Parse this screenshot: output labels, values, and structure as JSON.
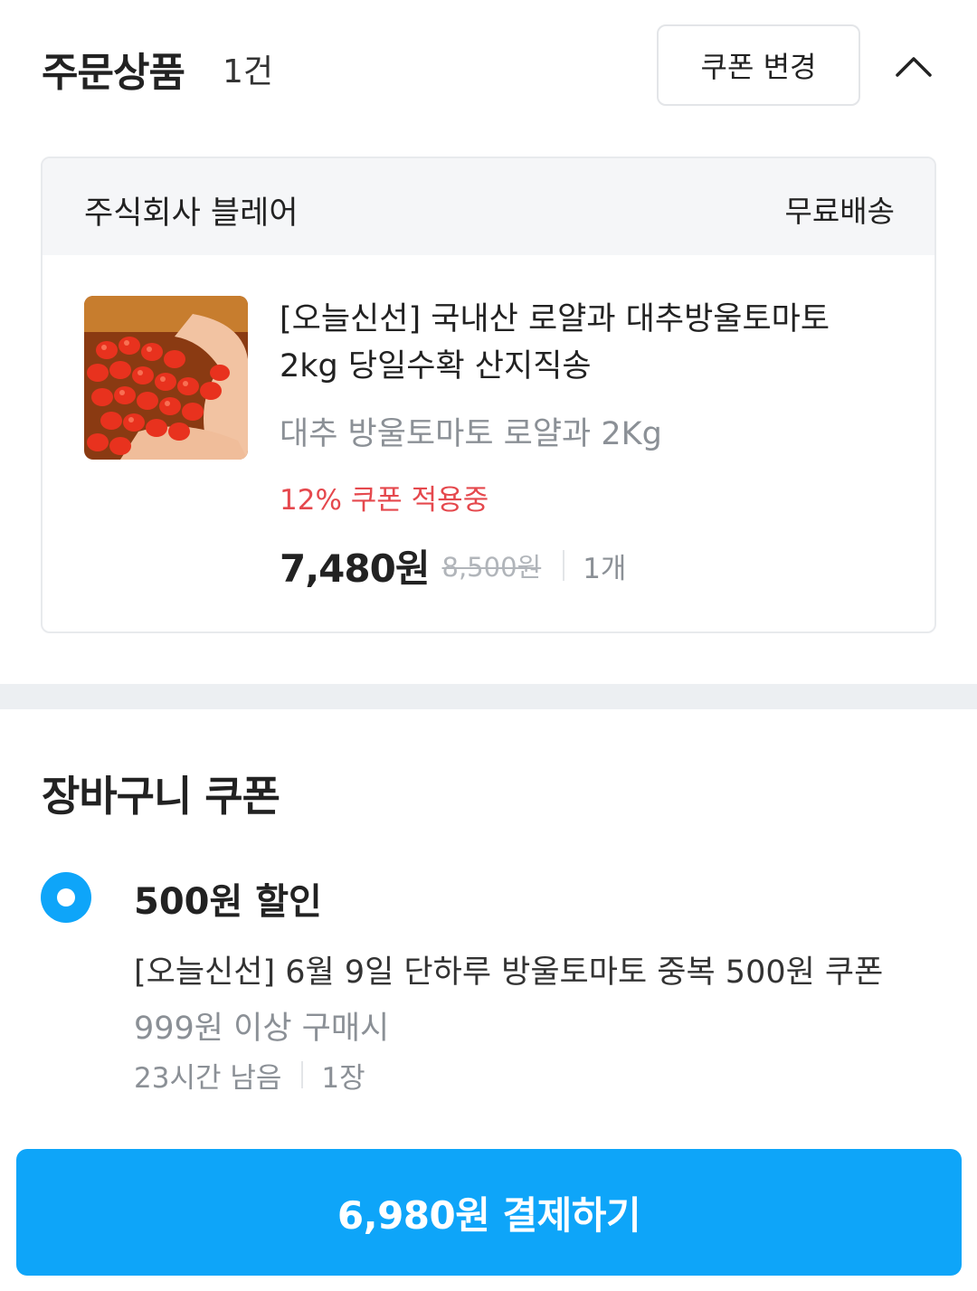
{
  "order": {
    "title": "주문상품",
    "count": "1건",
    "change_coupon_label": "쿠폰 변경",
    "collapse_icon": "chevron-up-icon"
  },
  "seller": {
    "name": "주식회사 블레어",
    "shipping": "무료배송"
  },
  "product": {
    "image_icon": "cherry-tomatoes-photo",
    "name": "[오늘신선] 국내산 로얄과 대추방울토마토 2kg 당일수확 산지직송",
    "option": "대추 방울토마토 로얄과 2Kg",
    "coupon_applied": "12% 쿠폰 적용중",
    "price": "7,480원",
    "original_price": "8,500원",
    "quantity": "1개"
  },
  "cart_coupon": {
    "title": "장바구니 쿠폰",
    "amount": "500원 할인",
    "name": "[오늘신선] 6월 9일 단하루 방울토마토 중복 500원 쿠폰",
    "condition": "999원 이상 구매시",
    "remaining": "23시간 남음",
    "quantity": "1장",
    "selected": true
  },
  "payment": {
    "button_label": "6,980원 결제하기"
  },
  "colors": {
    "accent": "#0ea5f9",
    "discount_red": "#e5484d",
    "muted_text": "#8b9096",
    "section_bg": "#f5f6f8"
  }
}
